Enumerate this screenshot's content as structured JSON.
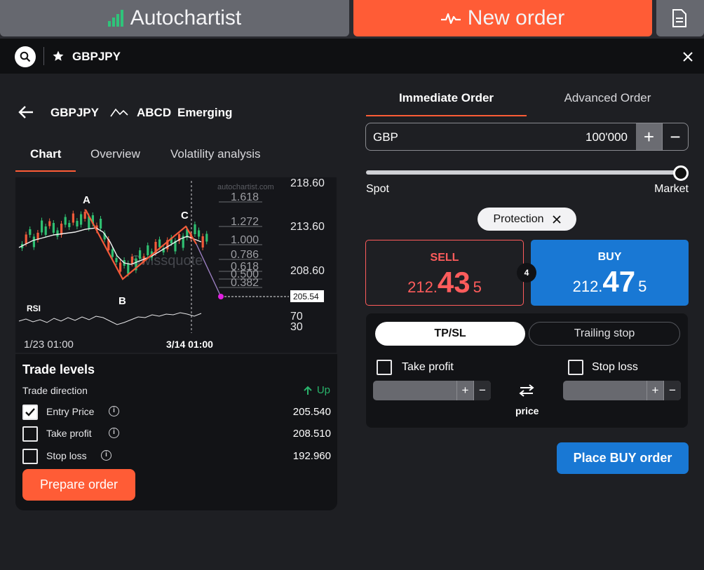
{
  "top_tabs": {
    "autochartist": "Autochartist",
    "new_order": "New order"
  },
  "search": {
    "symbol": "GBPJPY"
  },
  "pattern": {
    "symbol": "GBPJPY",
    "name": "ABCD",
    "status": "Emerging"
  },
  "analysis_tabs": [
    "Chart",
    "Overview",
    "Volatility analysis"
  ],
  "chart": {
    "watermark": "autochartist.com",
    "brand_watermark": "Swissquote",
    "price_labels": [
      "218.60",
      "213.60",
      "208.60"
    ],
    "fib_levels": [
      "1.618",
      "1.272",
      "1.000",
      "0.786",
      "0.618",
      "0.500",
      "0.382"
    ],
    "target_price": "205.54",
    "points": [
      "A",
      "B",
      "C"
    ],
    "rsi_label": "RSI",
    "rsi_levels": [
      "70",
      "30"
    ],
    "time_labels": [
      "1/23 01:00",
      "3/14 01:00"
    ]
  },
  "trade_levels": {
    "title": "Trade levels",
    "direction_label": "Trade direction",
    "direction_value": "Up",
    "rows": [
      {
        "label": "Entry Price",
        "value": "205.540",
        "checked": true
      },
      {
        "label": "Take profit",
        "value": "208.510",
        "checked": false
      },
      {
        "label": "Stop loss",
        "value": "192.960",
        "checked": false
      }
    ],
    "prepare_label": "Prepare order"
  },
  "order": {
    "tabs": {
      "immediate": "Immediate Order",
      "advanced": "Advanced Order"
    },
    "currency": "GBP",
    "quantity": "100'000",
    "slider": {
      "left": "Spot",
      "right": "Market",
      "position": 1.0
    },
    "protection": "Protection",
    "sell": {
      "title": "SELL",
      "prefix": "212.",
      "big": "43",
      "suffix": "5"
    },
    "buy": {
      "title": "BUY",
      "prefix": "212.",
      "big": "47",
      "suffix": "5"
    },
    "spread": "4",
    "modes": {
      "tpsl": "TP/SL",
      "trailing": "Trailing stop"
    },
    "take_profit": "Take profit",
    "stop_loss": "Stop loss",
    "swap_label": "price",
    "place_label": "Place BUY order"
  },
  "colors": {
    "accent": "#ff5c36",
    "buy": "#1978d4",
    "sell": "#ff5c5c",
    "up": "#29b36b"
  }
}
